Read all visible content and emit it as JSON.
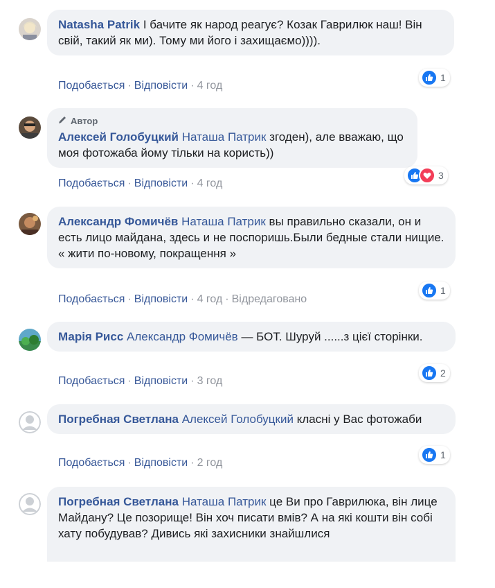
{
  "labels": {
    "like": "Подобається",
    "reply": "Відповісти",
    "edited": "Відредаговано",
    "author_badge": "Автор"
  },
  "colors": {
    "link": "#365899",
    "bubble": "#f0f2f5",
    "like": "#1877f2",
    "love": "#f33e58",
    "meta": "#90949c"
  },
  "comments": [
    {
      "author": "Natasha Patrik",
      "mention": "",
      "text": "І бачите як народ реагує? Козак Гаврилюк наш! Він свій, такий як ми). Тому ми його і захищаємо)))).",
      "time": "4 год",
      "reactions": [
        "like-icon"
      ],
      "reaction_count": "1",
      "avatar": "photo"
    },
    {
      "author": "Алексей Голобуцкий",
      "mention": "Наташа Патрик",
      "text": "згоден), але вважаю, що моя фотожаба йому тільки на користь))",
      "time": "4 год",
      "reactions": [
        "like-icon",
        "love-icon"
      ],
      "reaction_count": "3",
      "avatar": "photo",
      "is_author": true
    },
    {
      "author": "Александр Фомичёв",
      "mention": "Наташа Патрик",
      "text": "вы правильно сказали, он и есть лицо майдана, здесь и не поспоришь.Были бедные стали нищие. « жити по-новому, покращення »",
      "time": "4 год",
      "edited": true,
      "reactions": [
        "like-icon"
      ],
      "reaction_count": "1",
      "avatar": "photo"
    },
    {
      "author": "Марія Рисс",
      "mention": "Александр Фомичёв",
      "text": "— БОТ. Шуруй ......з цієї сторінки.",
      "time": "3 год",
      "reactions": [
        "like-icon"
      ],
      "reaction_count": "2",
      "avatar": "photo"
    },
    {
      "author": "Погребная Светлана",
      "mention": "Алексей Голобуцкий",
      "text": "класні у Вас фотожаби",
      "time": "2 год",
      "reactions": [
        "like-icon"
      ],
      "reaction_count": "1",
      "avatar": "default"
    },
    {
      "author": "Погребная Светлана",
      "mention": "Наташа Патрик",
      "text": "це Ви про Гаврилюка, він лице Майдану? Це позорище! Він хоч писати вмів? А на які кошти він собі хату побудував? Дивись які захисники знайшлися",
      "time": "",
      "reactions": [],
      "reaction_count": "",
      "avatar": "default"
    }
  ]
}
